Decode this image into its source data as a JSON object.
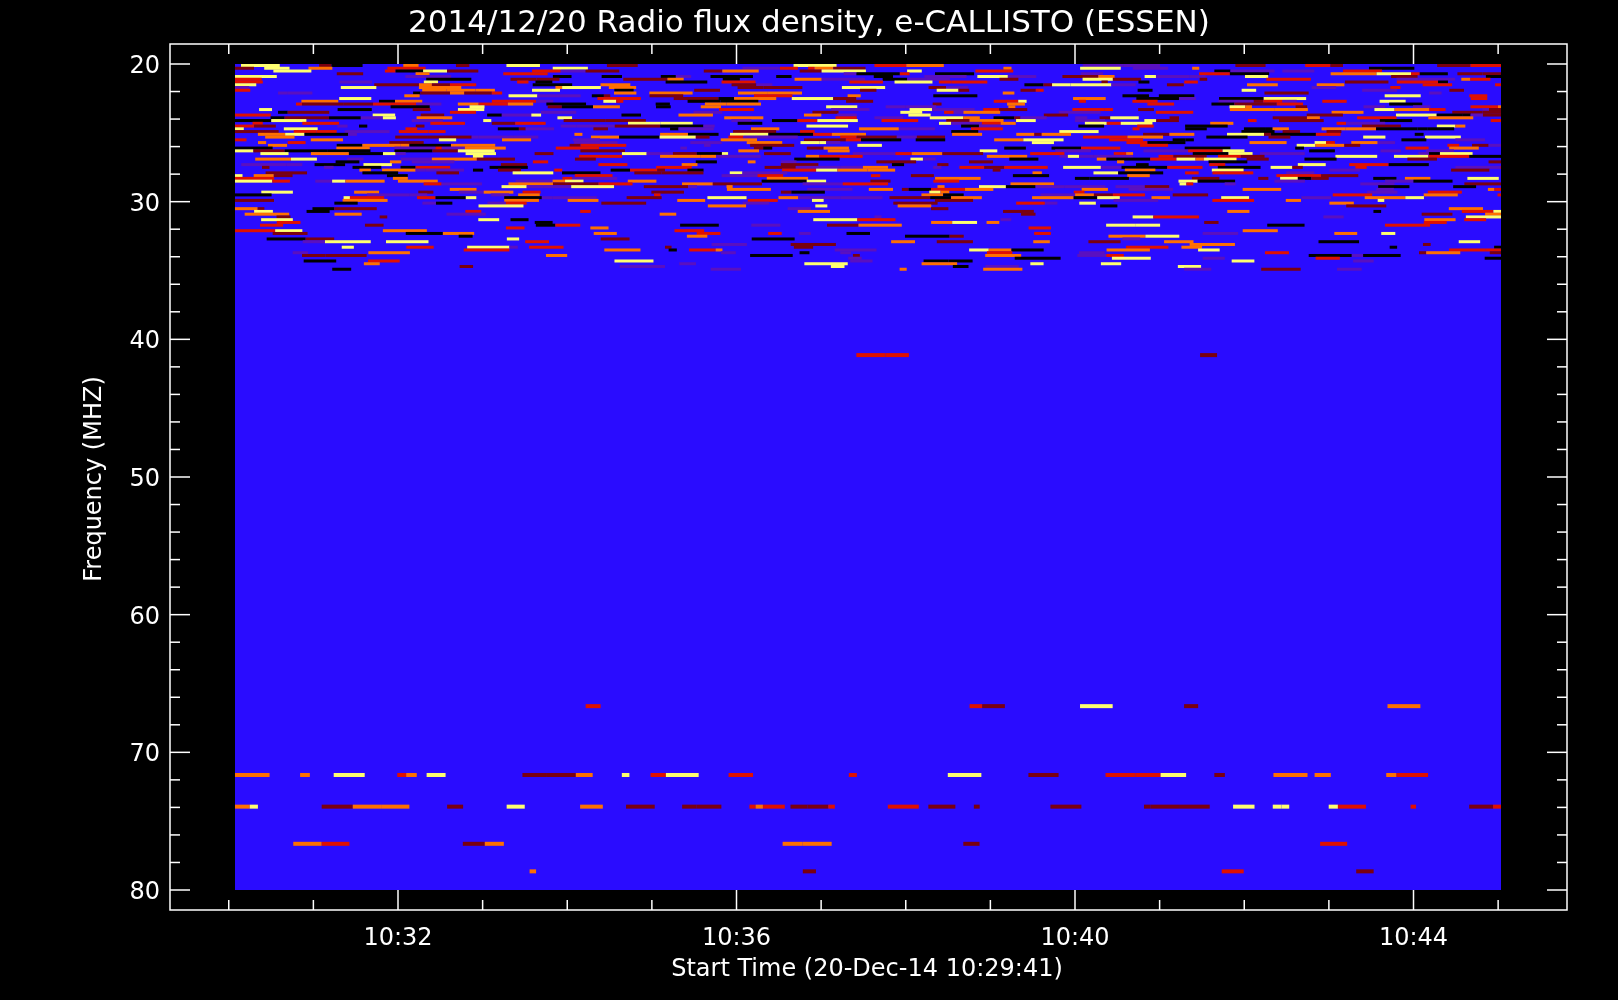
{
  "title": "2014/12/20  Radio flux density, e-CALLISTO (ESSEN)",
  "ylabel": "Frequency (MHZ)",
  "xlabel": "Start Time (20-Dec-14 10:29:41)",
  "yticks": [
    "20",
    "30",
    "40",
    "50",
    "60",
    "70",
    "80"
  ],
  "xticks": [
    "10:32",
    "10:36",
    "10:40",
    "10:44"
  ]
}
